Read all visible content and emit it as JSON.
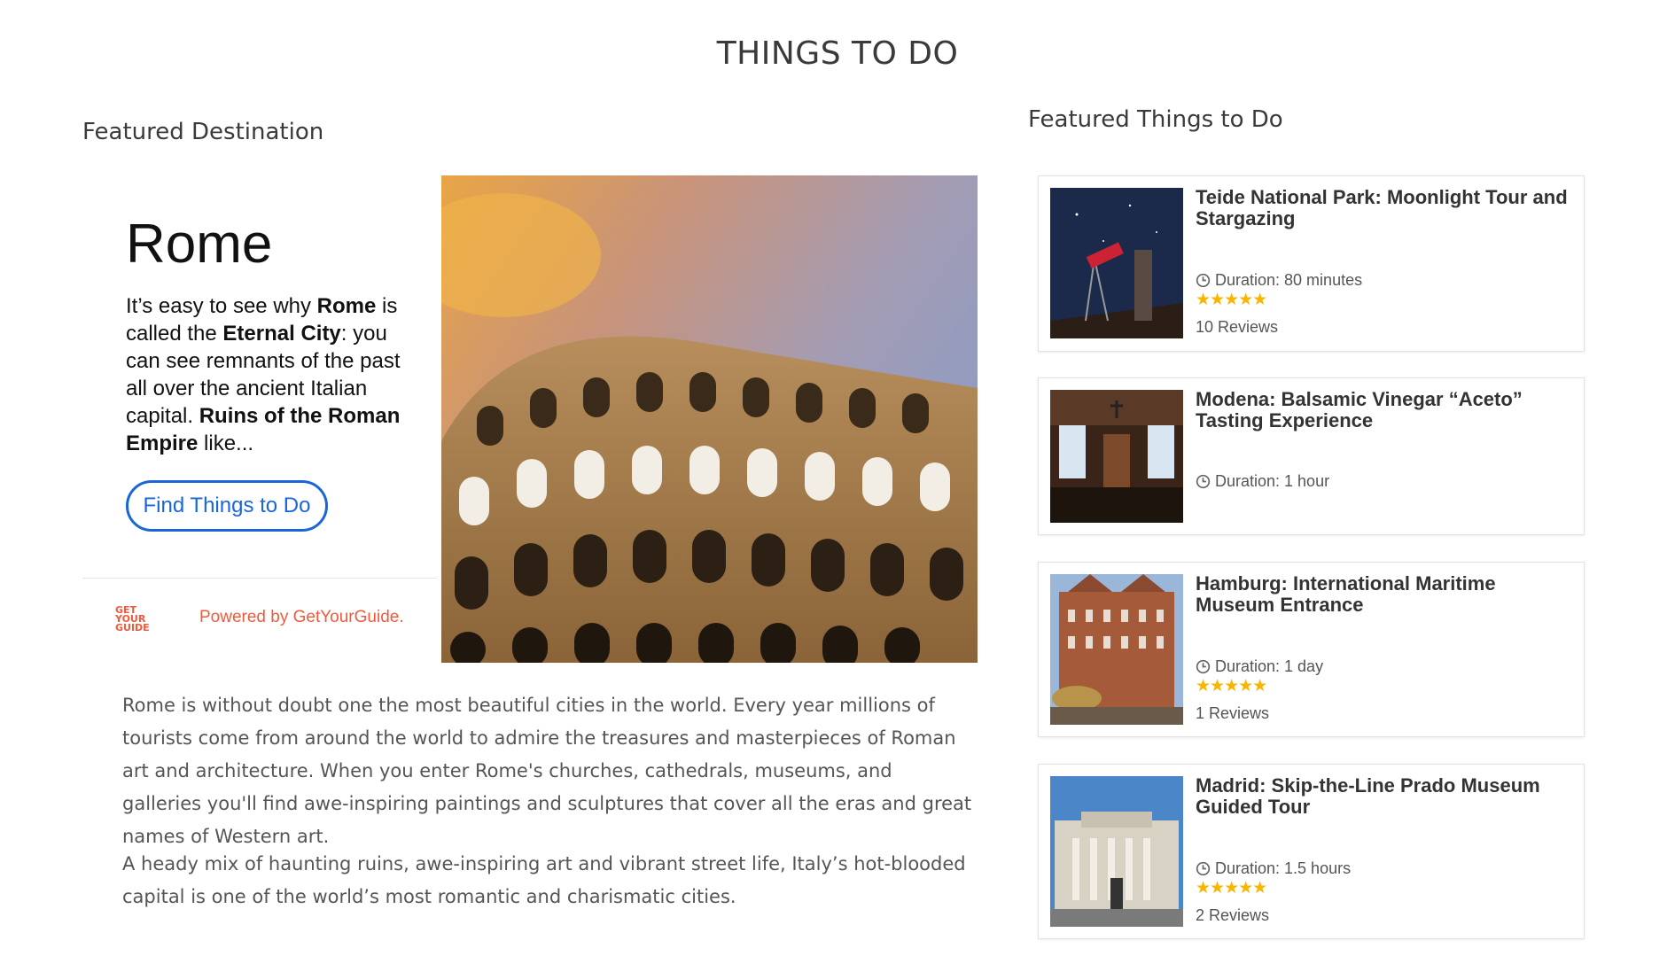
{
  "page": {
    "title": "THINGS TO DO"
  },
  "featured_destination": {
    "heading": "Featured Destination",
    "city": "Rome",
    "desc": {
      "p1": "It’s easy to see why ",
      "b1": "Rome",
      "p2": " is called the ",
      "b2": "Eternal City",
      "p3": ": you can see remnants of the past all over the ancient Italian capital. ",
      "b3": "Ruins of the Roman Empire",
      "p4": " like..."
    },
    "cta_label": "Find Things to Do",
    "powered_by": "Powered by GetYourGuide.",
    "logo_text": [
      "GET",
      "YOUR",
      "GUIDE"
    ],
    "image_icon": "colosseum-photo"
  },
  "article": {
    "paragraphs": [
      "Rome is without doubt one the most beautiful cities in the world. Every year millions of tourists come from around the world to admire the treasures and masterpieces of Roman art and architecture. When you enter Rome's churches, cathedrals, museums, and galleries you'll find awe-inspiring paintings and sculptures that cover all the eras and great names of Western art.",
      "A heady mix of haunting ruins, awe-inspiring art and vibrant street life, Italy’s hot-blooded capital is one of the world’s most romantic and charismatic cities."
    ]
  },
  "featured_things": {
    "heading": "Featured Things to Do",
    "cards": [
      {
        "title": "Teide National Park: Moonlight Tour and Stargazing",
        "duration": "Duration: 80 minutes",
        "stars": "★★★★★",
        "reviews": "10 Reviews"
      },
      {
        "title": "Modena: Balsamic Vinegar “Aceto” Tasting Experience",
        "duration": "Duration: 1 hour"
      },
      {
        "title": "Hamburg: International Maritime Museum Entrance",
        "duration": "Duration: 1 day",
        "stars": "★★★★★",
        "reviews": "1 Reviews"
      },
      {
        "title": "Madrid: Skip-the-Line Prado Museum Guided Tour",
        "duration": "Duration: 1.5 hours",
        "stars": "★★★★★",
        "reviews": "2 Reviews"
      }
    ]
  },
  "colors": {
    "accent_blue": "#1a66d8",
    "gyg_orange": "#f05a3c",
    "star": "#f7b500"
  }
}
